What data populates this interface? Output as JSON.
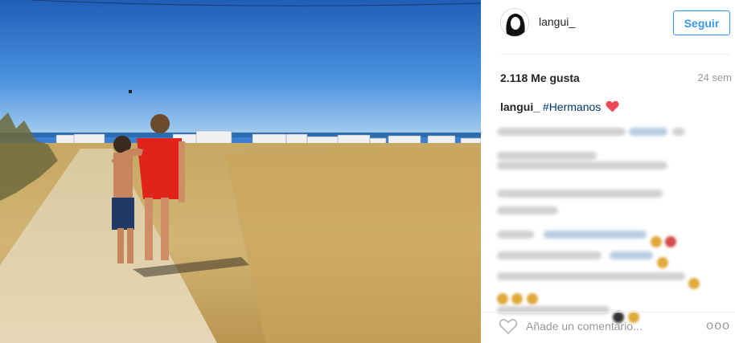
{
  "post": {
    "username": "langui_",
    "follow_label": "Seguir",
    "likes": "2.118 Me gusta",
    "age": "24 sem",
    "caption": {
      "username": "langui_",
      "hashtag": "#Hermanos"
    }
  },
  "footer": {
    "comment_placeholder": "Añade un comentario...",
    "more_label": "ooo"
  },
  "colors": {
    "accent": "#3897f0",
    "hashtag": "#003569",
    "heart": "#ed4956"
  }
}
